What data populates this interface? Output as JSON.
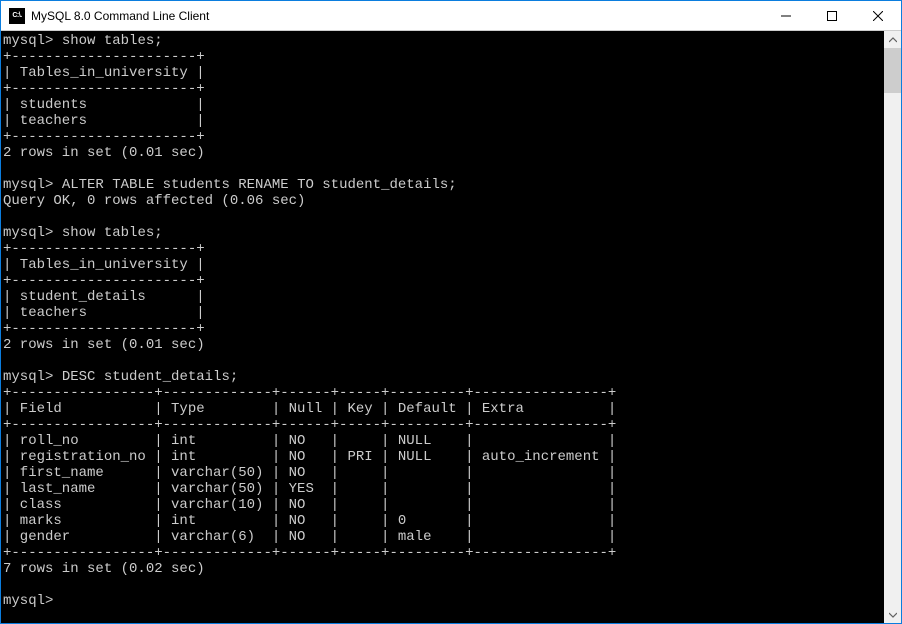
{
  "window": {
    "title": "MySQL 8.0 Command Line Client",
    "icon_text": "C:\\."
  },
  "terminal": {
    "prompt": "mysql>",
    "cmd1": "show tables;",
    "sep_tables": "+----------------------+",
    "hdr_tables": "| Tables_in_university |",
    "row_students": "| students             |",
    "row_teachers": "| teachers             |",
    "rows2": "2 rows in set (0.01 sec)",
    "cmd2": "ALTER TABLE students RENAME TO student_details;",
    "queryok": "Query OK, 0 rows affected (0.06 sec)",
    "cmd3": "show tables;",
    "row_student_details": "| student_details      |",
    "cmd4": "DESC student_details;",
    "desc_sep": "+-----------------+-------------+------+-----+---------+----------------+",
    "desc_hdr": "| Field           | Type        | Null | Key | Default | Extra          |",
    "r1": "| roll_no         | int         | NO   |     | NULL    |                |",
    "r2": "| registration_no | int         | NO   | PRI | NULL    | auto_increment |",
    "r3": "| first_name      | varchar(50) | NO   |     |         |                |",
    "r4": "| last_name       | varchar(50) | YES  |     |         |                |",
    "r5": "| class           | varchar(10) | NO   |     |         |                |",
    "r6": "| marks           | int         | NO   |     | 0       |                |",
    "r7": "| gender          | varchar(6)  | NO   |     | male    |                |",
    "rows7": "7 rows in set (0.02 sec)"
  },
  "chart_data": {
    "type": "table",
    "tables_in_university_before": [
      "students",
      "teachers"
    ],
    "tables_in_university_after": [
      "student_details",
      "teachers"
    ],
    "describe_student_details": {
      "columns": [
        "Field",
        "Type",
        "Null",
        "Key",
        "Default",
        "Extra"
      ],
      "rows": [
        {
          "Field": "roll_no",
          "Type": "int",
          "Null": "NO",
          "Key": "",
          "Default": "NULL",
          "Extra": ""
        },
        {
          "Field": "registration_no",
          "Type": "int",
          "Null": "NO",
          "Key": "PRI",
          "Default": "NULL",
          "Extra": "auto_increment"
        },
        {
          "Field": "first_name",
          "Type": "varchar(50)",
          "Null": "NO",
          "Key": "",
          "Default": "",
          "Extra": ""
        },
        {
          "Field": "last_name",
          "Type": "varchar(50)",
          "Null": "YES",
          "Key": "",
          "Default": "",
          "Extra": ""
        },
        {
          "Field": "class",
          "Type": "varchar(10)",
          "Null": "NO",
          "Key": "",
          "Default": "",
          "Extra": ""
        },
        {
          "Field": "marks",
          "Type": "int",
          "Null": "NO",
          "Key": "",
          "Default": "0",
          "Extra": ""
        },
        {
          "Field": "gender",
          "Type": "varchar(6)",
          "Null": "NO",
          "Key": "",
          "Default": "male",
          "Extra": ""
        }
      ]
    }
  }
}
